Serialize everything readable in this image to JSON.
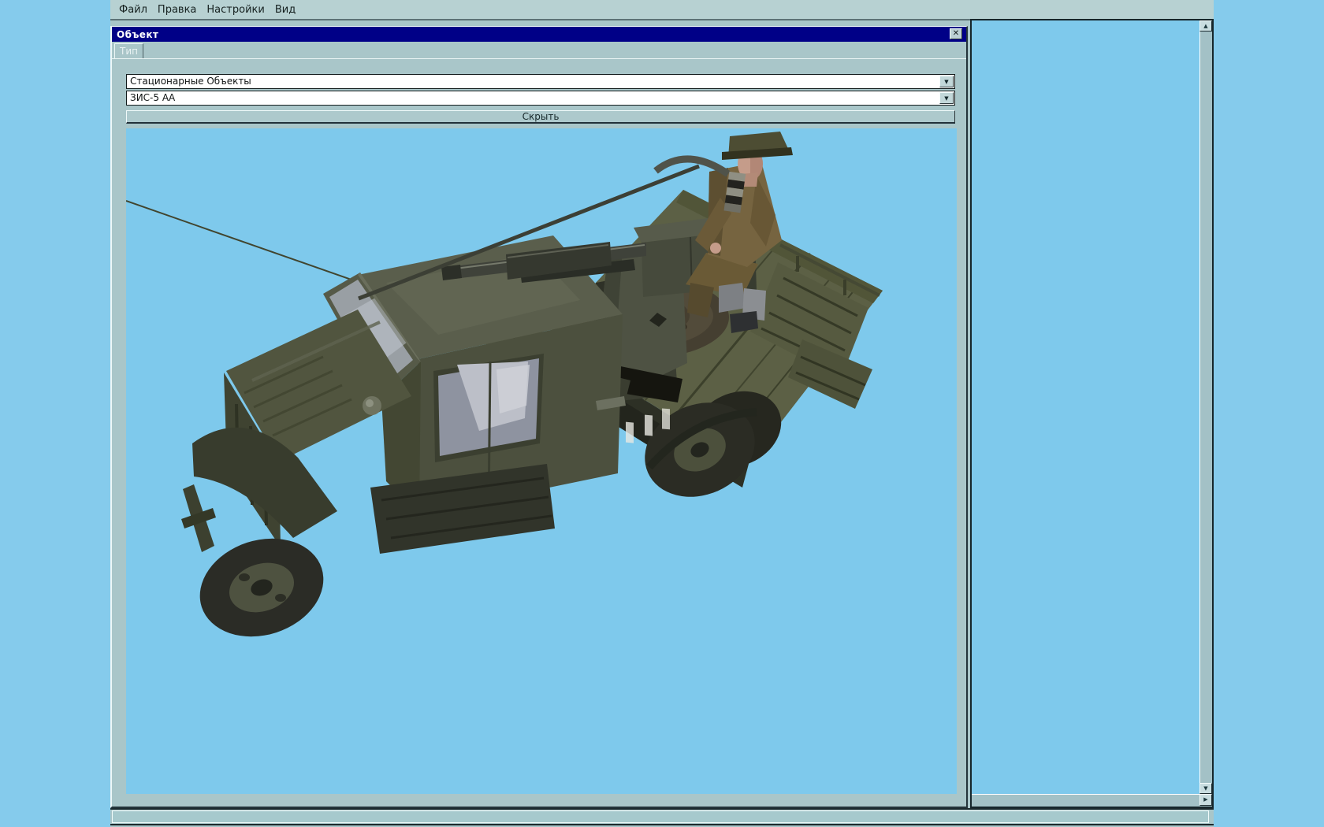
{
  "menu": {
    "items": [
      {
        "label": "Файл"
      },
      {
        "label": "Правка"
      },
      {
        "label": "Настройки"
      },
      {
        "label": "Вид"
      }
    ]
  },
  "object_window": {
    "title": "Объект",
    "tab": {
      "label": "Тип"
    },
    "category_dropdown": {
      "value": "Стационарные Объекты"
    },
    "model_dropdown": {
      "value": "ЗИС-5 АА"
    },
    "hide_button": {
      "label": "Скрыть"
    },
    "viewport": {
      "subject": "ЗИС-5 АА — грузовик с зенитной установкой и стрелком (3D модель)",
      "background_color": "#7ec9ec"
    }
  },
  "icons": {
    "close": "✕",
    "dropdown": "▼",
    "scroll_up": "▲",
    "scroll_down": "▼",
    "scroll_right": "▶"
  },
  "statusbar": {
    "text": ""
  },
  "colors": {
    "app_background": "#85cbec",
    "chrome": "#a9c6c9",
    "menu_background": "#b7d1d2",
    "titlebar": "#000087",
    "viewport_background": "#7ec9ec",
    "truck_olive": "#4c503e",
    "gunner_uniform": "#766440"
  }
}
